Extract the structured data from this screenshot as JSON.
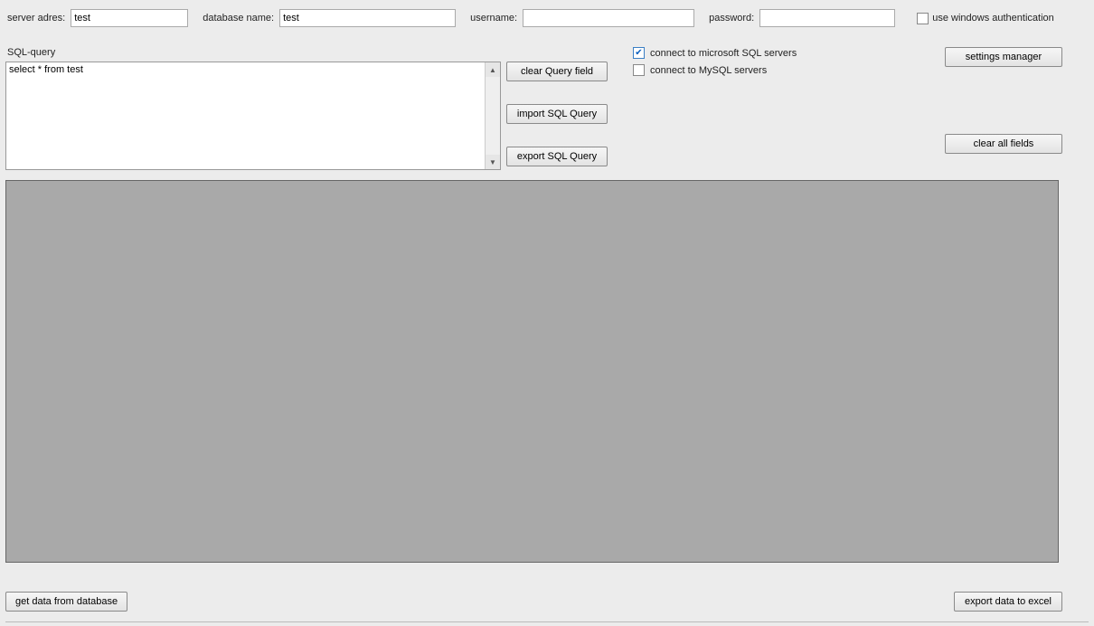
{
  "top": {
    "server_label": "server adres:",
    "server_value": "test",
    "db_label": "database name:",
    "db_value": "test",
    "user_label": "username:",
    "user_value": "",
    "pass_label": "password:",
    "pass_value": "",
    "winauth_label": "use windows authentication",
    "winauth_checked": false
  },
  "sql": {
    "label": "SQL-query",
    "value": "select * from test"
  },
  "buttons": {
    "clear_query": "clear Query field",
    "import_query": "import SQL Query",
    "export_query": "export SQL Query",
    "settings": "settings manager",
    "clear_all": "clear all fields",
    "get_data": "get data from database",
    "export_excel": "export data to excel"
  },
  "servers": {
    "ms_label": "connect to microsoft SQL servers",
    "ms_checked": true,
    "mysql_label": "connect to MySQL servers",
    "mysql_checked": false
  }
}
